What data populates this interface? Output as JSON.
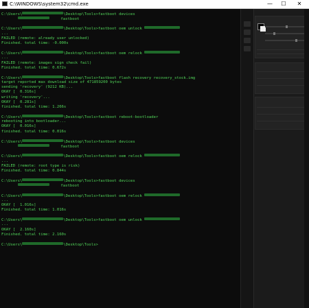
{
  "window": {
    "title": "C:\\WINDOWS\\system32\\cmd.exe",
    "controls": {
      "minimize": "—",
      "maximize": "☐",
      "close": "✕"
    }
  },
  "console": {
    "lines": [
      {
        "segments": [
          {
            "t": "C:\\Users\\"
          },
          {
            "blur": 60
          },
          {
            "t": "\\Desktop\\Tools>fastboot devices"
          }
        ]
      },
      {
        "segments": [
          {
            "t": "       "
          },
          {
            "blur": 46
          },
          {
            "t": "     fastboot"
          }
        ]
      },
      {
        "segments": [
          {
            "t": ""
          }
        ]
      },
      {
        "segments": [
          {
            "t": "C:\\Users\\"
          },
          {
            "blur": 60
          },
          {
            "t": "\\Desktop\\Tools>fastboot oem unlock "
          },
          {
            "blur": 52
          }
        ]
      },
      {
        "segments": [
          {
            "t": "..."
          }
        ]
      },
      {
        "segments": [
          {
            "t": "FAILED (remote: already user unlocked)"
          }
        ]
      },
      {
        "segments": [
          {
            "t": "Finished. total time: -0.000s"
          }
        ]
      },
      {
        "segments": [
          {
            "t": ""
          }
        ]
      },
      {
        "segments": [
          {
            "t": "C:\\Users\\"
          },
          {
            "blur": 60
          },
          {
            "t": "\\Desktop\\Tools>fastboot oem relock "
          },
          {
            "blur": 52
          }
        ]
      },
      {
        "segments": [
          {
            "t": "..."
          }
        ]
      },
      {
        "segments": [
          {
            "t": "FAILED (remote: images sign check fail)"
          }
        ]
      },
      {
        "segments": [
          {
            "t": "Finished. total time: 0.672s"
          }
        ]
      },
      {
        "segments": [
          {
            "t": ""
          }
        ]
      },
      {
        "segments": [
          {
            "t": "C:\\Users\\"
          },
          {
            "blur": 60
          },
          {
            "t": "\\Desktop\\Tools>fastboot flash recovery recovery_stock.img"
          }
        ]
      },
      {
        "segments": [
          {
            "t": "target reported max download size of 471859200 bytes"
          }
        ]
      },
      {
        "segments": [
          {
            "t": "sending 'recovery' (9212 KB)..."
          }
        ]
      },
      {
        "segments": [
          {
            "t": "OKAY [  0.316s]"
          }
        ]
      },
      {
        "segments": [
          {
            "t": "writing 'recovery'..."
          }
        ]
      },
      {
        "segments": [
          {
            "t": "OKAY [  0.281s]"
          }
        ]
      },
      {
        "segments": [
          {
            "t": "finished. total time: 1.266s"
          }
        ]
      },
      {
        "segments": [
          {
            "t": ""
          }
        ]
      },
      {
        "segments": [
          {
            "t": "C:\\Users\\"
          },
          {
            "blur": 60
          },
          {
            "t": "\\Desktop\\Tools>fastboot reboot-bootloader"
          }
        ]
      },
      {
        "segments": [
          {
            "t": "rebooting into bootloader..."
          }
        ]
      },
      {
        "segments": [
          {
            "t": "OKAY [  0.016s]"
          }
        ]
      },
      {
        "segments": [
          {
            "t": "finished. total time: 0.016s"
          }
        ]
      },
      {
        "segments": [
          {
            "t": ""
          }
        ]
      },
      {
        "segments": [
          {
            "t": "C:\\Users\\"
          },
          {
            "blur": 60
          },
          {
            "t": "\\Desktop\\Tools>fastboot devices"
          }
        ]
      },
      {
        "segments": [
          {
            "t": "       "
          },
          {
            "blur": 46
          },
          {
            "t": "     fastboot"
          }
        ]
      },
      {
        "segments": [
          {
            "t": ""
          }
        ]
      },
      {
        "segments": [
          {
            "t": "C:\\Users\\"
          },
          {
            "blur": 60
          },
          {
            "t": "\\Desktop\\Tools>fastboot oem relock "
          },
          {
            "blur": 52
          }
        ]
      },
      {
        "segments": [
          {
            "t": "..."
          }
        ]
      },
      {
        "segments": [
          {
            "t": "FAILED (remote: root type is risk)"
          }
        ]
      },
      {
        "segments": [
          {
            "t": "Finished. total time: 0.844s"
          }
        ]
      },
      {
        "segments": [
          {
            "t": ""
          }
        ]
      },
      {
        "segments": [
          {
            "t": "C:\\Users\\"
          },
          {
            "blur": 60
          },
          {
            "t": "\\Desktop\\Tools>fastboot devices"
          }
        ]
      },
      {
        "segments": [
          {
            "t": "       "
          },
          {
            "blur": 46
          },
          {
            "t": "     fastboot"
          }
        ]
      },
      {
        "segments": [
          {
            "t": ""
          }
        ]
      },
      {
        "segments": [
          {
            "t": "C:\\Users\\"
          },
          {
            "blur": 60
          },
          {
            "t": "\\Desktop\\Tools>fastboot oem relock "
          },
          {
            "blur": 52
          }
        ]
      },
      {
        "segments": [
          {
            "t": "..."
          }
        ]
      },
      {
        "segments": [
          {
            "t": "OKAY [  1.016s]"
          }
        ]
      },
      {
        "segments": [
          {
            "t": "Finished. total time: 1.016s"
          }
        ]
      },
      {
        "segments": [
          {
            "t": ""
          }
        ]
      },
      {
        "segments": [
          {
            "t": "C:\\Users\\"
          },
          {
            "blur": 60
          },
          {
            "t": "\\Desktop\\Tools>fastboot oem unlock "
          },
          {
            "blur": 52
          }
        ]
      },
      {
        "segments": [
          {
            "t": "..."
          }
        ]
      },
      {
        "segments": [
          {
            "t": "OKAY [  2.160s]"
          }
        ]
      },
      {
        "segments": [
          {
            "t": "Finished. total time: 2.160s"
          }
        ]
      },
      {
        "segments": [
          {
            "t": ""
          }
        ]
      },
      {
        "segments": [
          {
            "t": "C:\\Users\\"
          },
          {
            "blur": 60
          },
          {
            "t": "\\Desktop\\Tools>"
          }
        ]
      }
    ]
  },
  "colors": {
    "console_bg": "#0c0c0c",
    "console_text": "#52d65a",
    "redaction": "#1f6a2a",
    "titlebar_bg": "#ffffff"
  },
  "icons": {
    "title_icon": "cmd-icon",
    "minimize": "minimize-icon",
    "maximize": "maximize-icon",
    "close": "close-icon"
  }
}
